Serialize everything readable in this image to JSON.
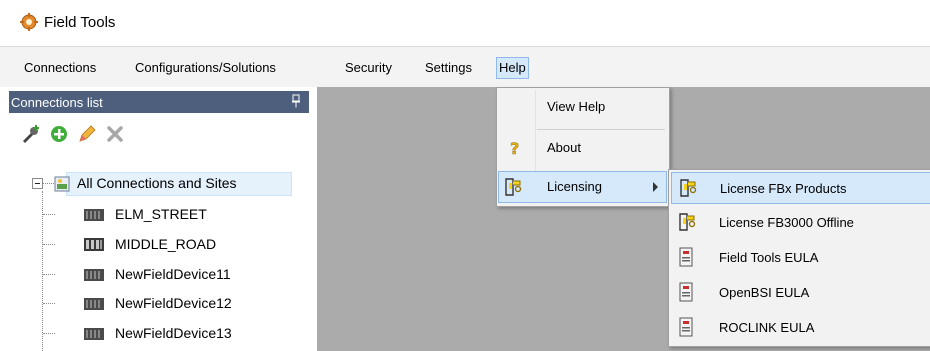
{
  "app": {
    "title": "Field Tools"
  },
  "menubar": {
    "items": [
      {
        "label": "Connections"
      },
      {
        "label": "Configurations/Solutions"
      },
      {
        "label": "Security"
      },
      {
        "label": "Settings"
      },
      {
        "label": "Help"
      }
    ]
  },
  "panel": {
    "title": "Connections list",
    "toolbar": [
      {
        "icon": "add-connection-icon"
      },
      {
        "icon": "add-icon"
      },
      {
        "icon": "edit-pencil-icon"
      },
      {
        "icon": "delete-icon"
      }
    ]
  },
  "tree": {
    "root": "All Connections and Sites",
    "children": [
      "ELM_STREET",
      "MIDDLE_ROAD",
      "NewFieldDevice11",
      "NewFieldDevice12",
      "NewFieldDevice13"
    ]
  },
  "help_menu": {
    "items": [
      {
        "label": "View Help"
      },
      {
        "label": "About"
      },
      {
        "label": "Licensing"
      }
    ]
  },
  "licensing_submenu": {
    "items": [
      {
        "label": "License FBx Products"
      },
      {
        "label": "License FB3000 Offline"
      },
      {
        "label": "Field Tools EULA"
      },
      {
        "label": "OpenBSI EULA"
      },
      {
        "label": "ROCLINK EULA"
      }
    ]
  },
  "colors": {
    "panel_header": "#4d5f7c",
    "highlight": "#d6e9fa",
    "highlight_border": "#8fb9e8"
  }
}
